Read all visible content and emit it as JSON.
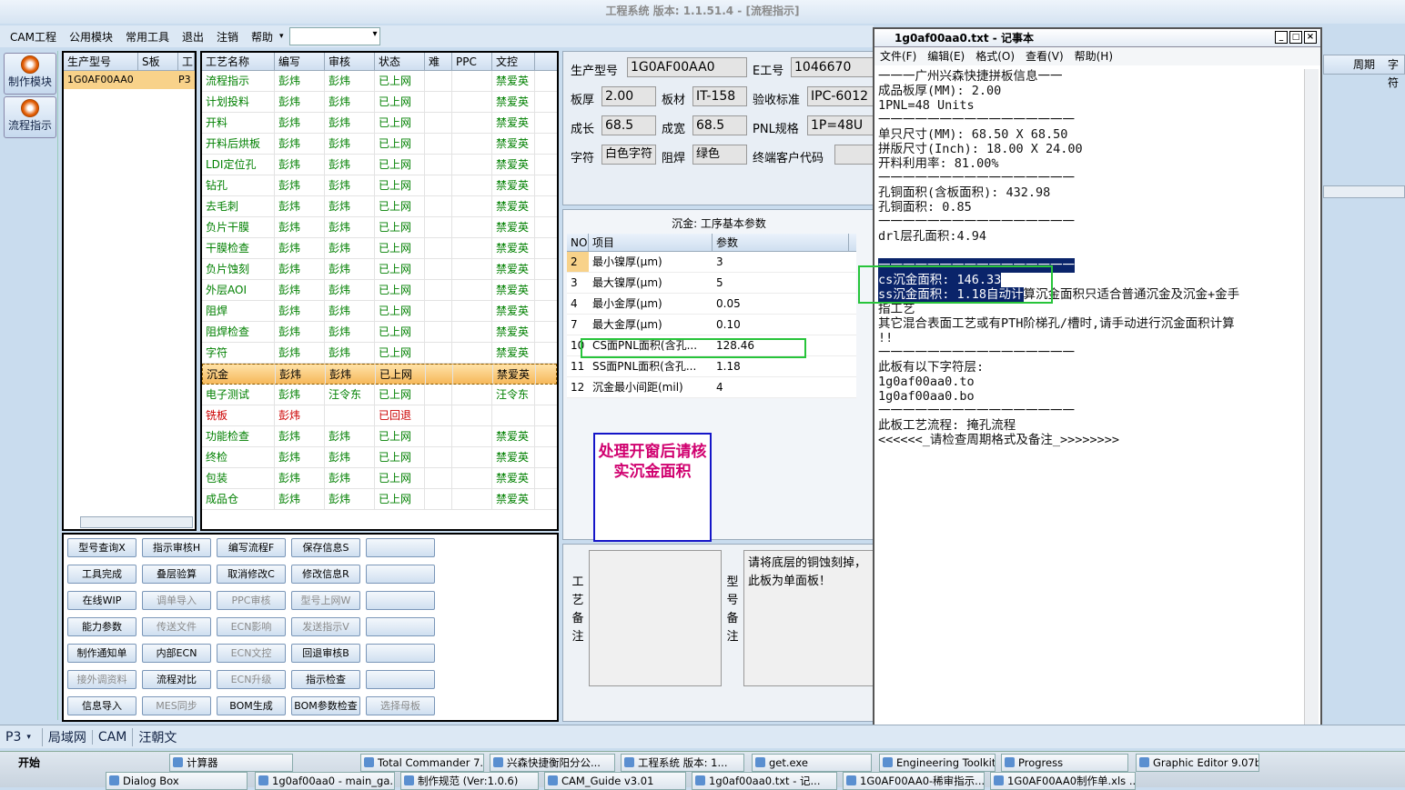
{
  "app_title": "工程系统  版本: 1.1.51.4 - [流程指示]",
  "menu": [
    "CAM工程",
    "公用模块",
    "常用工具",
    "退出",
    "注销",
    "帮助"
  ],
  "left_buttons": [
    "制作模块",
    "流程指示"
  ],
  "prod_list": {
    "headers": [
      "生产型号",
      "S板",
      "工"
    ],
    "rows": [
      {
        "model": "1G0AF00AA0",
        "s": "",
        "w": "P3"
      }
    ]
  },
  "flow": {
    "headers": [
      "工艺名称",
      "编写",
      "审核",
      "状态",
      "难",
      "PPC",
      "文控"
    ],
    "rows": [
      {
        "name": "流程指示",
        "writer": "彭炜",
        "reviewer": "彭炜",
        "status": "已上网",
        "doc": "禁爱英"
      },
      {
        "name": "计划投料",
        "writer": "彭炜",
        "reviewer": "彭炜",
        "status": "已上网",
        "doc": "禁爱英"
      },
      {
        "name": "开料",
        "writer": "彭炜",
        "reviewer": "彭炜",
        "status": "已上网",
        "doc": "禁爱英"
      },
      {
        "name": "开料后烘板",
        "writer": "彭炜",
        "reviewer": "彭炜",
        "status": "已上网",
        "doc": "禁爱英"
      },
      {
        "name": "LDI定位孔",
        "writer": "彭炜",
        "reviewer": "彭炜",
        "status": "已上网",
        "doc": "禁爱英"
      },
      {
        "name": "钻孔",
        "writer": "彭炜",
        "reviewer": "彭炜",
        "status": "已上网",
        "doc": "禁爱英"
      },
      {
        "name": "去毛刺",
        "writer": "彭炜",
        "reviewer": "彭炜",
        "status": "已上网",
        "doc": "禁爱英"
      },
      {
        "name": "负片干膜",
        "writer": "彭炜",
        "reviewer": "彭炜",
        "status": "已上网",
        "doc": "禁爱英"
      },
      {
        "name": "干膜检查",
        "writer": "彭炜",
        "reviewer": "彭炜",
        "status": "已上网",
        "doc": "禁爱英"
      },
      {
        "name": "负片蚀刻",
        "writer": "彭炜",
        "reviewer": "彭炜",
        "status": "已上网",
        "doc": "禁爱英"
      },
      {
        "name": "外层AOI",
        "writer": "彭炜",
        "reviewer": "彭炜",
        "status": "已上网",
        "doc": "禁爱英"
      },
      {
        "name": "阻焊",
        "writer": "彭炜",
        "reviewer": "彭炜",
        "status": "已上网",
        "doc": "禁爱英"
      },
      {
        "name": "阻焊检查",
        "writer": "彭炜",
        "reviewer": "彭炜",
        "status": "已上网",
        "doc": "禁爱英"
      },
      {
        "name": "字符",
        "writer": "彭炜",
        "reviewer": "彭炜",
        "status": "已上网",
        "doc": "禁爱英"
      },
      {
        "name": "沉金",
        "writer": "彭炜",
        "reviewer": "彭炜",
        "status": "已上网",
        "doc": "禁爱英",
        "selected": true
      },
      {
        "name": "电子测试",
        "writer": "彭炜",
        "reviewer": "汪令东",
        "status": "已上网",
        "doc": "汪令东"
      },
      {
        "name": "铣板",
        "writer": "彭炜",
        "reviewer": "",
        "status": "已回退",
        "doc": "",
        "red": true
      },
      {
        "name": "功能检查",
        "writer": "彭炜",
        "reviewer": "彭炜",
        "status": "已上网",
        "doc": "禁爱英"
      },
      {
        "name": "终检",
        "writer": "彭炜",
        "reviewer": "彭炜",
        "status": "已上网",
        "doc": "禁爱英"
      },
      {
        "name": "包装",
        "writer": "彭炜",
        "reviewer": "彭炜",
        "status": "已上网",
        "doc": "禁爱英"
      },
      {
        "name": "成品仓",
        "writer": "彭炜",
        "reviewer": "彭炜",
        "status": "已上网",
        "doc": "禁爱英"
      }
    ]
  },
  "buttons": [
    {
      "l": "型号查询X",
      "d": false
    },
    {
      "l": "指示审核H",
      "d": false
    },
    {
      "l": "编写流程F",
      "d": false
    },
    {
      "l": "保存信息S",
      "d": false
    },
    {
      "l": "",
      "d": false
    },
    {
      "l": "工具完成",
      "d": false
    },
    {
      "l": "叠层验算",
      "d": false
    },
    {
      "l": "取消修改C",
      "d": false
    },
    {
      "l": "修改信息R",
      "d": false
    },
    {
      "l": "",
      "d": false
    },
    {
      "l": "在线WIP",
      "d": false
    },
    {
      "l": "调单导入",
      "d": true
    },
    {
      "l": "PPC审核",
      "d": true
    },
    {
      "l": "型号上网W",
      "d": true
    },
    {
      "l": "",
      "d": false
    },
    {
      "l": "能力参数",
      "d": false
    },
    {
      "l": "传送文件",
      "d": true
    },
    {
      "l": "ECN影响",
      "d": true
    },
    {
      "l": "发送指示V",
      "d": true
    },
    {
      "l": "",
      "d": false
    },
    {
      "l": "制作通知单",
      "d": false
    },
    {
      "l": "内部ECN",
      "d": false
    },
    {
      "l": "ECN文控",
      "d": true
    },
    {
      "l": "回退审核B",
      "d": false
    },
    {
      "l": "",
      "d": false
    },
    {
      "l": "接外调资料",
      "d": true
    },
    {
      "l": "流程对比",
      "d": false
    },
    {
      "l": "ECN升级",
      "d": true
    },
    {
      "l": "指示检查",
      "d": false
    },
    {
      "l": "",
      "d": false
    },
    {
      "l": "信息导入",
      "d": false
    },
    {
      "l": "MES同步",
      "d": true
    },
    {
      "l": "BOM生成",
      "d": false
    },
    {
      "l": "BOM参数检查",
      "d": false
    },
    {
      "l": "选择母板",
      "d": true
    }
  ],
  "info": {
    "prod_label": "生产型号",
    "prod_val": "1G0AF00AA0",
    "e_label": "E工号",
    "e_val": "1046670",
    "thick_label": "板厚",
    "thick_val": "2.00",
    "mat_label": "板材",
    "mat_val": "IT-158",
    "std_label": "验收标准",
    "std_val": "IPC-6012",
    "len_label": "成长",
    "len_val": "68.5",
    "wid_label": "成宽",
    "wid_val": "68.5",
    "pnl_label": "PNL规格",
    "pnl_val": "1P=48U",
    "char_label": "字符",
    "char_val": "白色字符",
    "sm_label": "阻焊",
    "sm_val": "绿色",
    "cust_label": "终端客户代码",
    "cust_val": ""
  },
  "params": {
    "title": "沉金: 工序基本参数",
    "headers": [
      "NO",
      "项目",
      "参数"
    ],
    "rows": [
      {
        "no": "2",
        "item": "最小镍厚(μm)",
        "val": "3"
      },
      {
        "no": "3",
        "item": "最大镍厚(μm)",
        "val": "5"
      },
      {
        "no": "4",
        "item": "最小金厚(μm)",
        "val": "0.05"
      },
      {
        "no": "7",
        "item": "最大金厚(μm)",
        "val": "0.10"
      },
      {
        "no": "10",
        "item": "CS面PNL面积(含孔...",
        "val": "128.46"
      },
      {
        "no": "11",
        "item": "SS面PNL面积(含孔...",
        "val": "1.18"
      },
      {
        "no": "12",
        "item": "沉金最小间距(mil)",
        "val": "4"
      }
    ]
  },
  "note_text": "处理开窗后请核实沉金面积",
  "remarks": {
    "proc_label": "工艺备注",
    "model_label": "型号备注",
    "model_text": "请将底层的铜蚀刻掉，此板为单面板！"
  },
  "right_headers": [
    "周期",
    "字符"
  ],
  "notepad": {
    "title": "1g0af00aa0.txt - 记事本",
    "menu": [
      "文件(F)",
      "编辑(E)",
      "格式(O)",
      "查看(V)",
      "帮助(H)"
    ],
    "text": "一一一广州兴森快捷拼板信息一一\n成品板厚(MM): 2.00\n1PNL=48 Units\n一一一一一一一一一一一一一一一一\n单只尺寸(MM): 68.50 X 68.50\n拼版尺寸(Inch): 18.00 X 24.00\n开料利用率: 81.00%\n一一一一一一一一一一一一一一一一\n孔铜面积(含板面积): 432.98\n孔铜面积: 0.85\n一一一一一一一一一一一一一一一一\ndrl层孔面积:4.94\n\n",
    "sel_line": "一一一一一一一一一一一一一一一一",
    "cs_line": "cs沉金面积: 146.33",
    "ss_line": "ss沉金面积: 1.18自动计",
    "ss_rest": "算沉金面积只适合普通沉金及沉金+金手",
    "text2": "指工艺\n其它混合表面工艺或有PTH阶梯孔/槽时,请手动进行沉金面积计算\n!!\n一一一一一一一一一一一一一一一一\n此板有以下字符层:\n1g0af00aa0.to\n1g0af00aa0.bo\n一一一一一一一一一一一一一一一一\n此板工艺流程: 掩孔流程\n<<<<<<_请检查周期格式及备注_>>>>>>>>"
  },
  "status": [
    "P3",
    "局域网",
    "CAM",
    "汪朝文"
  ],
  "taskbar": {
    "start": "开始",
    "row1": [
      "计算器",
      "Total Commander 7....",
      "兴森快捷衡阳分公...",
      "工程系统  版本: 1...",
      "get.exe",
      "Engineering Toolkit 9...",
      "Progress",
      "Graphic Editor 9.07b..."
    ],
    "row2": [
      "Dialog Box",
      "1g0af00aa0 - main_ga...",
      "制作规范 (Ver:1.0.6)",
      "CAM_Guide v3.01",
      "1g0af00aa0.txt - 记...",
      "1G0AF00AA0-稀审指示...",
      "1G0AF00AA0制作单.xls ..."
    ]
  }
}
